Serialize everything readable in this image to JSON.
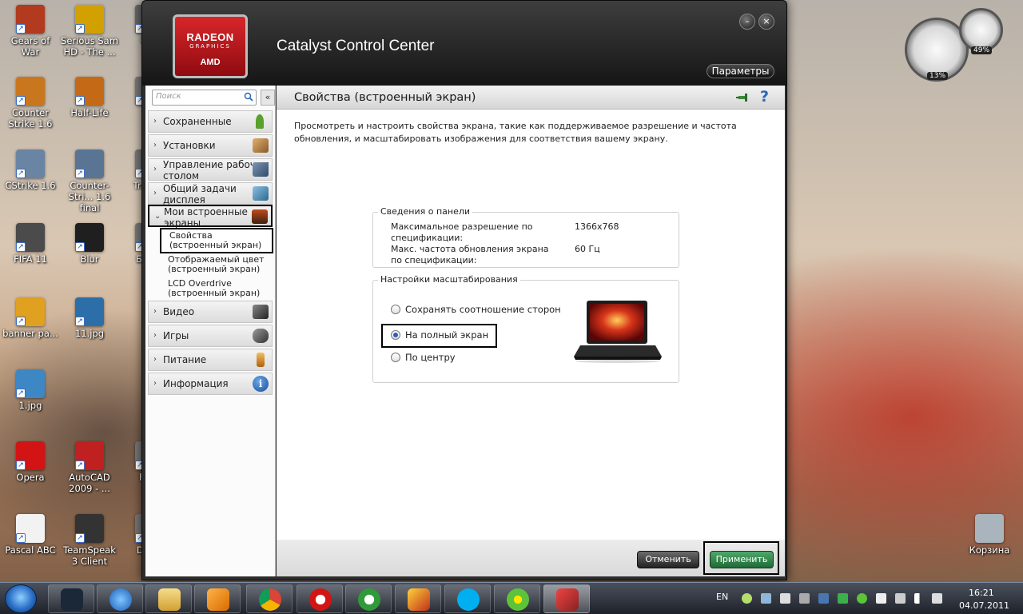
{
  "desktop": {
    "icons": [
      {
        "label": "Gears of War",
        "color": "#b23a1f"
      },
      {
        "label": "Serious Sam HD - The ...",
        "color": "#d2a000"
      },
      {
        "label": "Cou",
        "color": "#666"
      },
      {
        "label": "Counter Strike 1.6",
        "color": "#c9771e"
      },
      {
        "label": "Half-Life",
        "color": "#c46a16"
      },
      {
        "label": "Mi",
        "color": "#777"
      },
      {
        "label": "CStrike 1.6",
        "color": "#6a85a3"
      },
      {
        "label": "Counter-Stri... 1.6 final",
        "color": "#5a7594"
      },
      {
        "label": "Tra Nat",
        "color": "#777"
      },
      {
        "label": "FIFA 11",
        "color": "#4b4b4b"
      },
      {
        "label": "Blur",
        "color": "#1f1f1f"
      },
      {
        "label": "Б Сре",
        "color": "#777"
      },
      {
        "label": "banner ра...",
        "color": "#e0a020"
      },
      {
        "label": "11.jpg",
        "color": "#2c6fa8"
      },
      {
        "label": "1.jpg",
        "color": "#3d87c4"
      },
      {
        "label": "Opera",
        "color": "#d21414"
      },
      {
        "label": "AutoCAD 2009 - ...",
        "color": "#c02020"
      },
      {
        "label": "F HY",
        "color": "#777"
      },
      {
        "label": "Pascal ABC",
        "color": "#f2f2f2"
      },
      {
        "label": "TeamSpeak 3 Client",
        "color": "#333"
      },
      {
        "label": "DA To",
        "color": "#777"
      },
      {
        "label": "Корзина",
        "color": "#aab4bd"
      }
    ],
    "gadget": {
      "cpu_pct": "13%",
      "mem_pct": "49%"
    }
  },
  "window": {
    "logo_line1": "RADEON",
    "logo_line2": "GRAPHICS",
    "logo_line3": "AMD",
    "title": "Catalyst Control Center",
    "params_label": "Параметры",
    "minimize_glyph": "–",
    "close_glyph": "×"
  },
  "sidebar": {
    "search_placeholder": "Поиск",
    "collapse_glyph": "«",
    "items": [
      {
        "label": "Сохраненные",
        "icon": "pin-icon",
        "color": "#5aa02c"
      },
      {
        "label": "Установки",
        "icon": "presets-icon",
        "color": "#b07a3c"
      },
      {
        "label": "Управление рабочим столом",
        "icon": "desktop-icon",
        "color": "#4c6a8c"
      },
      {
        "label": "Общий задачи дисплея",
        "icon": "display-icon",
        "color": "#3d7fa8"
      },
      {
        "label": "Мои встроенные экраны",
        "icon": "laptop-icon",
        "color": "#5a3a20"
      },
      {
        "label": "Видео",
        "icon": "camera-icon",
        "color": "#444"
      },
      {
        "label": "Игры",
        "icon": "gamepad-icon",
        "color": "#555"
      },
      {
        "label": "Питание",
        "icon": "battery-icon",
        "color": "#d08a20"
      },
      {
        "label": "Информация",
        "icon": "info-icon",
        "color": "#2b68b7"
      }
    ],
    "subitems": [
      {
        "label": "Свойства (встроенный экран)"
      },
      {
        "label": "Отображаемый цвет (встроенный экран)"
      },
      {
        "label": "LCD Overdrive (встроенный экран)"
      }
    ]
  },
  "content": {
    "title": "Свойства (встроенный экран)",
    "help_glyph": "?",
    "description": "Просмотреть и настроить свойства экрана, такие как поддерживаемое разрешение и частота обновления, и масштабировать изображения для соответствия вашему экрану.",
    "panel_info": {
      "legend": "Сведения о панели",
      "rows": [
        {
          "label": "Максимальное разрешение по спецификации:",
          "value": "1366x768"
        },
        {
          "label": "Макс. частота обновления экрана по спецификации:",
          "value": "60 Гц"
        }
      ]
    },
    "scaling": {
      "legend": "Настройки масштабирования",
      "options": [
        {
          "label": "Сохранять соотношение сторон",
          "checked": false
        },
        {
          "label": "На полный экран",
          "checked": true
        },
        {
          "label": "По центру",
          "checked": false
        }
      ]
    },
    "cancel_label": "Отменить",
    "apply_label": "Применить"
  },
  "taskbar": {
    "lang": "EN",
    "time": "16:21",
    "date": "04.07.2011"
  }
}
